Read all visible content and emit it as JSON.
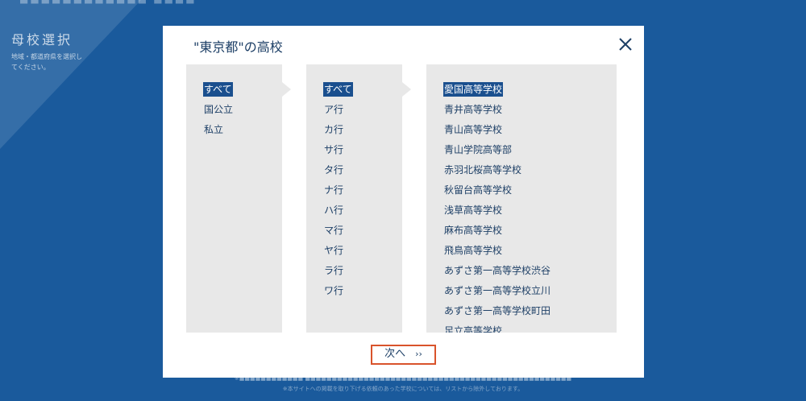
{
  "background": {
    "top_text": "■■■■■■■■■■■■ ■■■■",
    "title": "母校選択",
    "subtitle": "地域・都道府県を選択してください。",
    "footer_line1": "※■■■■■■■■■■■■ ■■■■■■■■■■■■■■■■■■■■■■■■■■■■■■■■■■■■■■■■■■■■■■■■■■",
    "footer_line2": "※本サイトへの掲載を取り下げる依頼のあった学校については、リストから除外しております。"
  },
  "modal": {
    "title": "\"東京都\"の高校",
    "next_label": "次へ",
    "next_chevron": "››"
  },
  "column1": {
    "items": [
      "すべて",
      "国公立",
      "私立"
    ],
    "selected_index": 0
  },
  "column2": {
    "items": [
      "すべて",
      "ア行",
      "カ行",
      "サ行",
      "タ行",
      "ナ行",
      "ハ行",
      "マ行",
      "ヤ行",
      "ラ行",
      "ワ行"
    ],
    "selected_index": 0
  },
  "column3": {
    "items": [
      "愛国高等学校",
      "青井高等学校",
      "青山高等学校",
      "青山学院高等部",
      "赤羽北桜高等学校",
      "秋留台高等学校",
      "浅草高等学校",
      "麻布高等学校",
      "飛鳥高等学校",
      "あずさ第一高等学校渋谷",
      "あずさ第一高等学校立川",
      "あずさ第一高等学校町田",
      "足立高等学校"
    ],
    "selected_index": 0
  },
  "colors": {
    "background": "#1a5a9c",
    "selected": "#1a4f8e",
    "next_border": "#d9532b",
    "text": "#1d3f66"
  }
}
